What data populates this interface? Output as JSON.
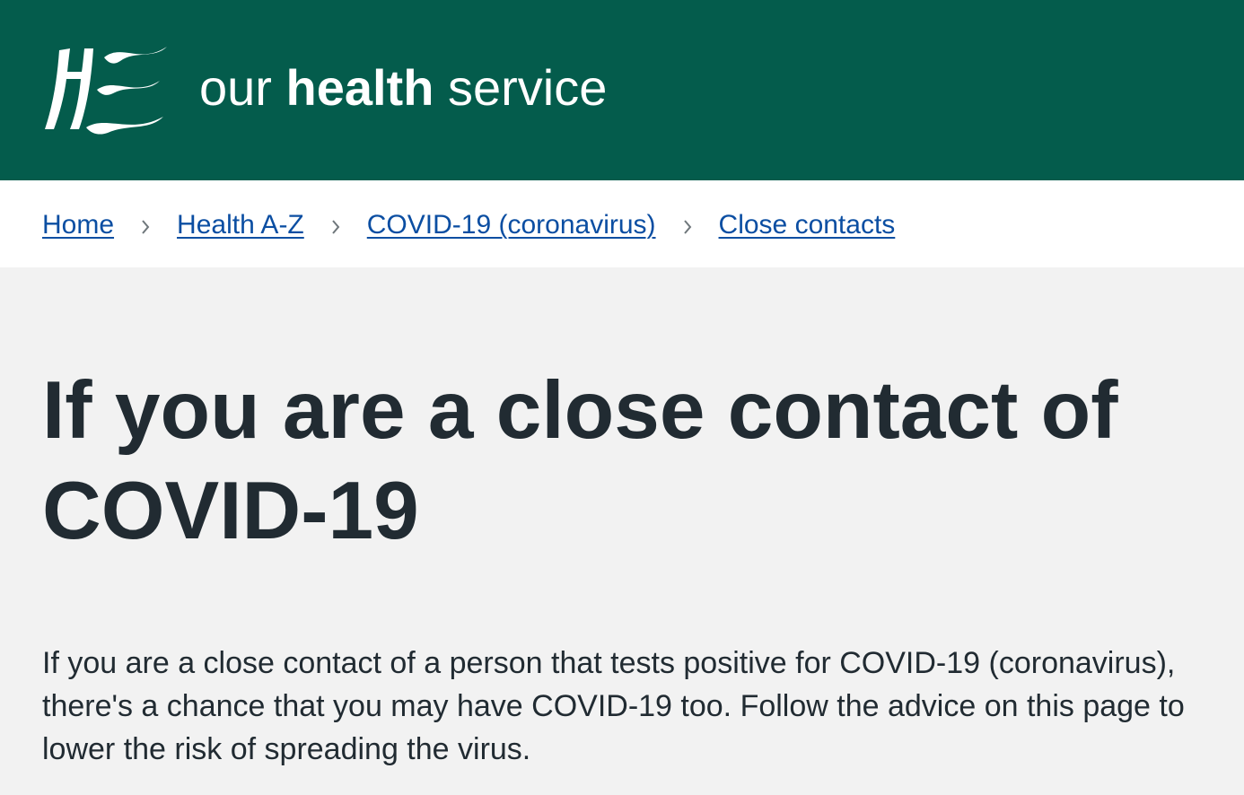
{
  "header": {
    "logo_text": "HSE",
    "tagline_prefix": "our ",
    "tagline_bold": "health",
    "tagline_suffix": " service",
    "background_color": "#045c4c"
  },
  "breadcrumb": {
    "items": [
      {
        "label": "Home"
      },
      {
        "label": "Health A-Z"
      },
      {
        "label": "COVID-19 (coronavirus)"
      },
      {
        "label": "Close contacts"
      }
    ],
    "separator_icon": "chevron-right-icon",
    "link_color": "#0b4ea2"
  },
  "main": {
    "title": "If you are a close contact of COVID-19",
    "intro": "If you are a close contact of a person that tests positive for COVID-19 (coronavirus), there's a chance that you may have COVID-19 too. Follow the advice on this page to lower the risk of spreading the virus."
  }
}
